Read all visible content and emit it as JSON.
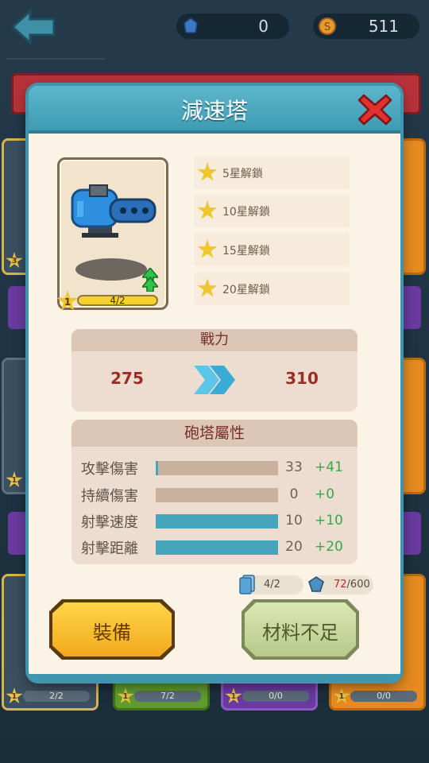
{
  "topbar": {
    "gems": "0",
    "coins": "511"
  },
  "bg_cards": [
    {
      "star": "3",
      "bar": ""
    },
    {
      "star": "1",
      "bar": ""
    },
    {
      "star": "1",
      "bar": "2/2"
    },
    {
      "star": "1",
      "bar": "7/2"
    },
    {
      "star": "1",
      "bar": "0/0"
    },
    {
      "star": "1",
      "bar": "0/0"
    }
  ],
  "modal": {
    "title": "減速塔",
    "turret": {
      "level": "1",
      "progress": "4/2",
      "progress_fraction": 1.0
    },
    "unlocks": [
      {
        "label": "5星解鎖"
      },
      {
        "label": "10星解鎖"
      },
      {
        "label": "15星解鎖"
      },
      {
        "label": "20星解鎖"
      }
    ],
    "power": {
      "header": "戰力",
      "current": "275",
      "next": "310"
    },
    "attributes": {
      "header": "砲塔屬性",
      "rows": [
        {
          "name": "攻擊傷害",
          "value": "33",
          "bonus": "+41",
          "fill": 0.02
        },
        {
          "name": "持續傷害",
          "value": "0",
          "bonus": "+0",
          "fill": 0
        },
        {
          "name": "射擊速度",
          "value": "10",
          "bonus": "+10",
          "fill": 1.0
        },
        {
          "name": "射擊距離",
          "value": "20",
          "bonus": "+20",
          "fill": 1.0
        }
      ]
    },
    "materials": {
      "cards": "4/2",
      "gems_have": "72",
      "gems_need": "/600"
    },
    "buttons": {
      "equip": "裝備",
      "insufficient": "材料不足"
    }
  },
  "colors": {
    "header": "#4aa8bf",
    "panel": "#ecddd0",
    "power_text": "#9a2d25",
    "bonus": "#38a84a",
    "shortfall": "#c72121",
    "equip_button": "#f5b82a",
    "disabled_button": "#c7d59c"
  }
}
